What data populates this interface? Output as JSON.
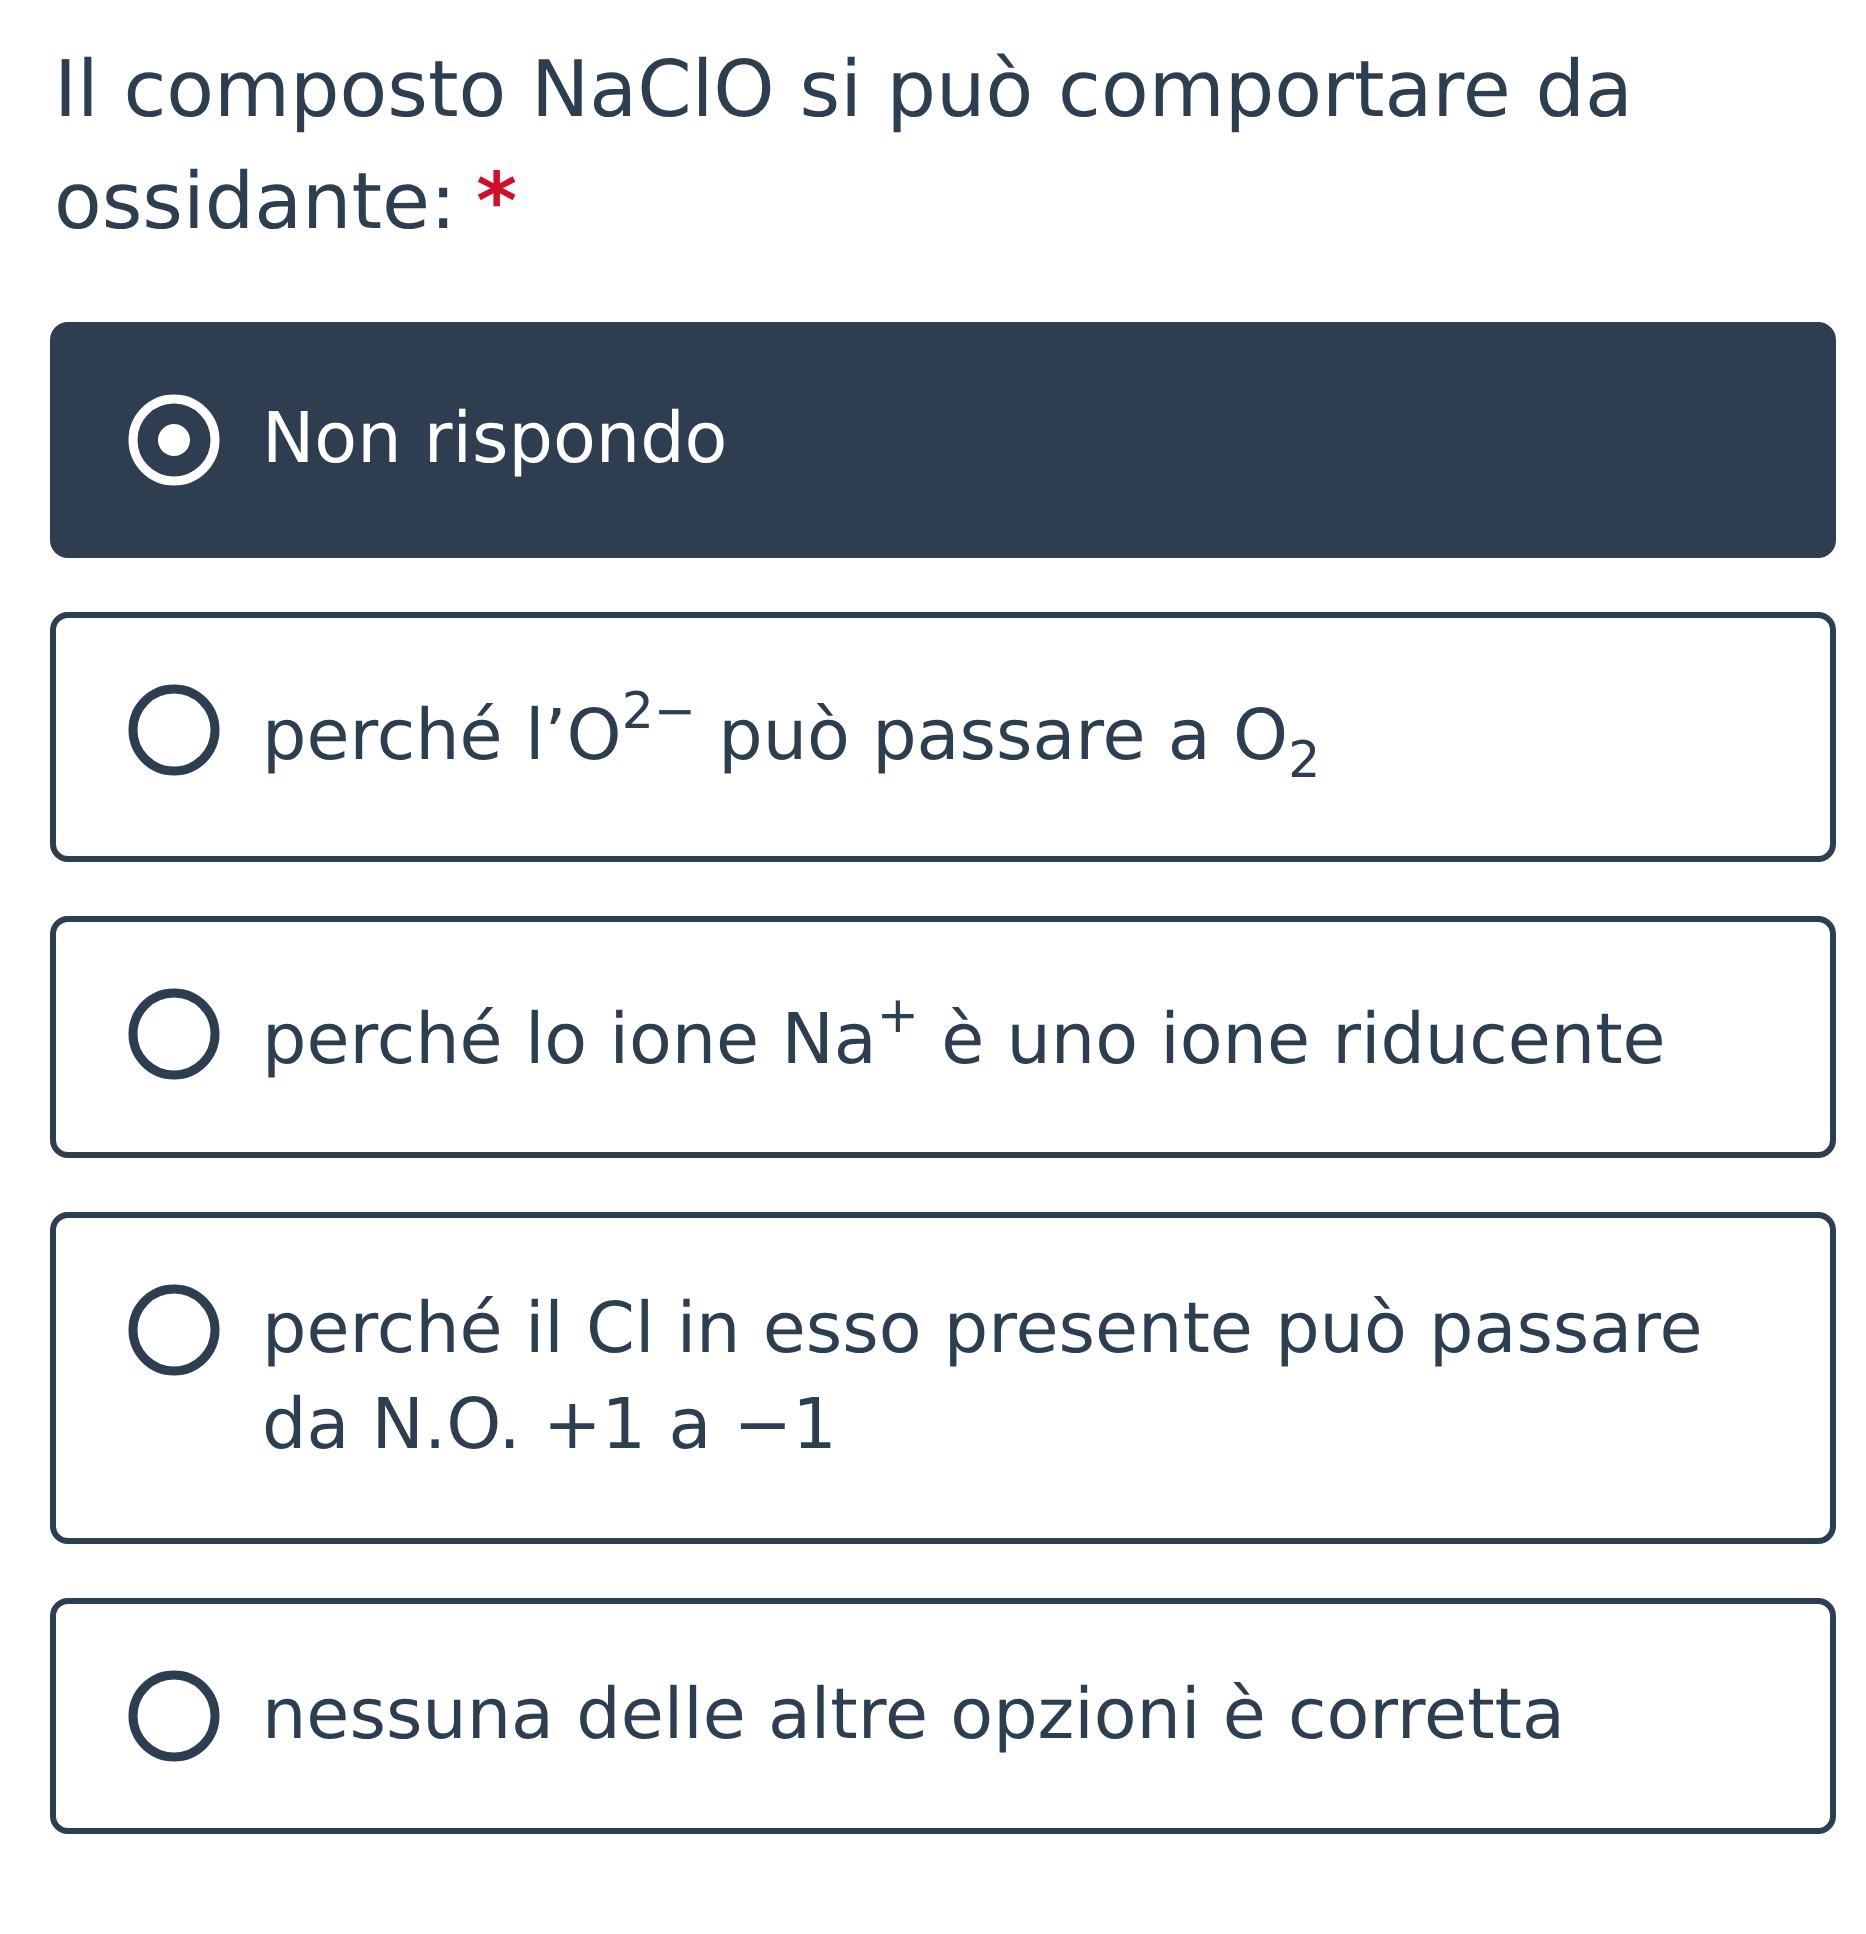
{
  "question": {
    "text": "Il composto NaClO si può comportare da ossidante:",
    "required_mark": "*"
  },
  "options": [
    {
      "text": "Non rispondo",
      "selected": true
    },
    {
      "text": "perché l’O$^{2−}$ può passare a O$_{2}$",
      "selected": false
    },
    {
      "text": "perché lo ione Na$^{+}$ è uno ione riducente",
      "selected": false
    },
    {
      "text": "perché il Cl in esso presente può passare da N.O. +1 a −1",
      "selected": false
    },
    {
      "text": "nessuna delle altre opzioni è corretta",
      "selected": false
    }
  ]
}
